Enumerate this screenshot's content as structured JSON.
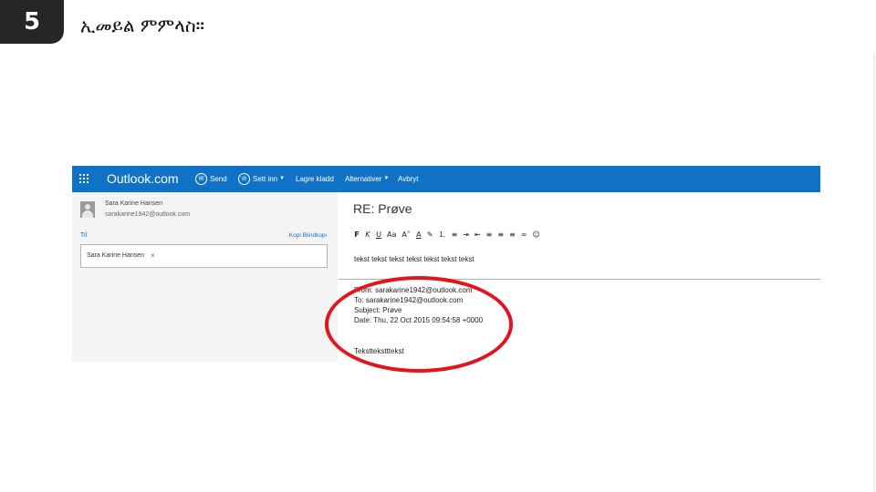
{
  "slide": {
    "number": "5",
    "title": "ኢመይል ምምላስ።"
  },
  "toolbar": {
    "brand": "Outlook.com",
    "send": "Send",
    "insert": "Sett inn",
    "save_draft": "Lagre kladd",
    "options": "Alternativer",
    "cancel": "Avbryt"
  },
  "left_pane": {
    "sender_name": "Sara Karine Hansen",
    "sender_email": "sarakarine1942@outlook.com",
    "to_label": "Til",
    "copy_links": "Kopi Blindkopi",
    "recipient_chip": "Sara Karine Hansen"
  },
  "message": {
    "subject": "RE: Prøve",
    "body": "tekst tekst tekst tekst tekst tekst tekst",
    "quoted": {
      "from": "From: sarakarine1942@outlook.com",
      "to": "To: sarakarine1942@outlook.com",
      "subject": "Subject: Prøve",
      "date": "Date: Thu, 22 Oct 2015 09:54:58 +0000",
      "body": "Teksttekstttekst"
    }
  },
  "colors": {
    "accent": "#0f72c6",
    "highlight": "#e3141e"
  }
}
